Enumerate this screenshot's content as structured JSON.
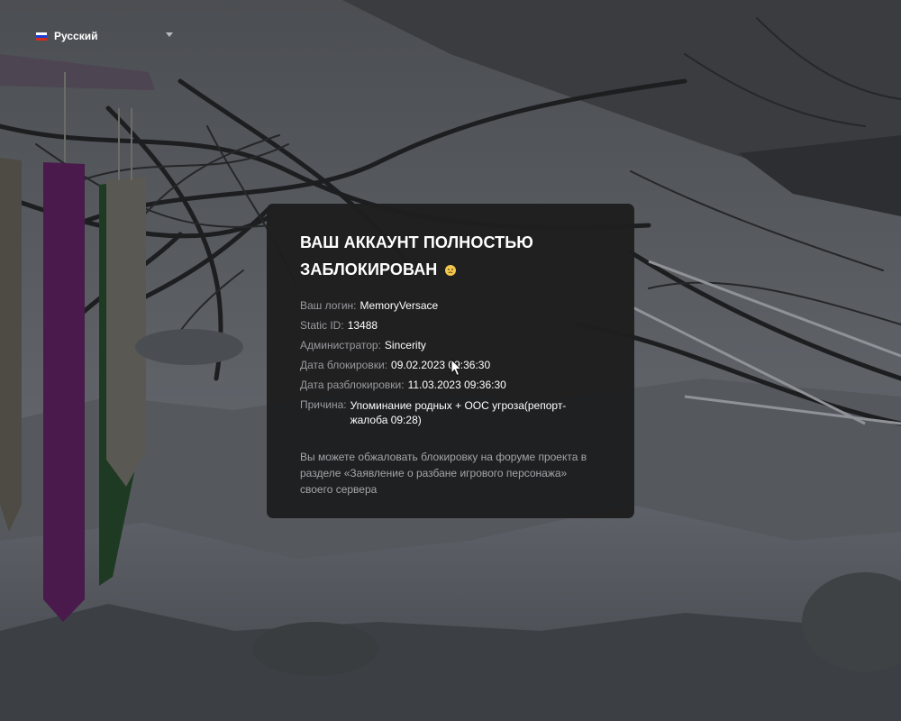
{
  "language": {
    "label": "Русский",
    "flag_colors": [
      "#ffffff",
      "#1c3fd0",
      "#d52b1e"
    ]
  },
  "ban": {
    "title_line1": "ВАШ АККАУНТ ПОЛНОСТЬЮ",
    "title_line2": "ЗАБЛОКИРОВАН",
    "title_emoji": "sad-face-emoji",
    "fields": {
      "login_label": "Ваш логин:",
      "login_value": "MemoryVersace",
      "static_id_label": "Static ID:",
      "static_id_value": "13488",
      "admin_label": "Администратор:",
      "admin_value": "Sincerity",
      "ban_date_label": "Дата блокировки:",
      "ban_date_value": "09.02.2023 09:36:30",
      "unban_date_label": "Дата разблокировки:",
      "unban_date_value": "11.03.2023 09:36:30",
      "reason_label": "Причина:",
      "reason_value": "Упоминание родных + ООС угроза(репорт-жалоба 09:28)"
    },
    "appeal_note": "Вы можете обжаловать блокировку на форуме проекта в разделе «Заявление о разбане игрового персонажа» своего сервера"
  },
  "colors": {
    "card_background": "#1e1e1f",
    "label_text": "#9a9b9e",
    "value_text": "#ffffff",
    "note_text": "#a4a5a8"
  }
}
